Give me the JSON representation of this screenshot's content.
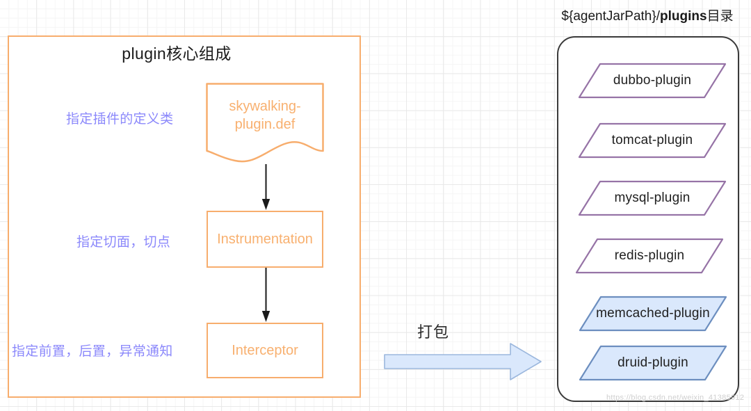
{
  "canvas": {
    "background": "#ffffff",
    "grid_minor_color": "#f5f5f5",
    "grid_major_color": "#e8e8e8"
  },
  "colors": {
    "orange": "#f7ad6d",
    "orange_text": "#f8b06f",
    "annotation_purple": "#8b88fb",
    "parallelogram_purple_border": "#9673a6",
    "parallelogram_blue_border": "#6c8ebf",
    "parallelogram_blue_fill": "#dae8fc",
    "container_border": "#3a3a3a",
    "arrow_dark": "#2b2b2b",
    "block_arrow_fill": "#dae8fc",
    "block_arrow_border": "#9bb7dd"
  },
  "left_panel": {
    "title": "plugin核心组成",
    "annotations": [
      {
        "label": "指定插件的定义类"
      },
      {
        "label": "指定切面，切点"
      },
      {
        "label": "指定前置，后置，异常通知"
      }
    ],
    "nodes": [
      {
        "label": "skywalking-\nplugin.def",
        "line1": "skywalking-",
        "line2": "plugin.def",
        "shape": "document"
      },
      {
        "label": "Instrumentation",
        "shape": "rectangle"
      },
      {
        "label": "Interceptor",
        "shape": "rectangle"
      }
    ]
  },
  "middle": {
    "arrow_label": "打包",
    "arrow_icon": "block-arrow-right-icon"
  },
  "right_panel": {
    "title_prefix": "${agentJarPath}/",
    "title_bold": "plugins",
    "title_suffix": "目录",
    "plugins": [
      {
        "label": "dubbo-plugin",
        "style": "purple"
      },
      {
        "label": "tomcat-plugin",
        "style": "purple"
      },
      {
        "label": "mysql-plugin",
        "style": "purple"
      },
      {
        "label": "redis-plugin",
        "style": "purple"
      },
      {
        "label": "memcached-plugin",
        "style": "blue"
      },
      {
        "label": "druid-plugin",
        "style": "blue"
      }
    ]
  },
  "watermark": {
    "text": "https://blog.csdn.net/weixin_41385912"
  }
}
